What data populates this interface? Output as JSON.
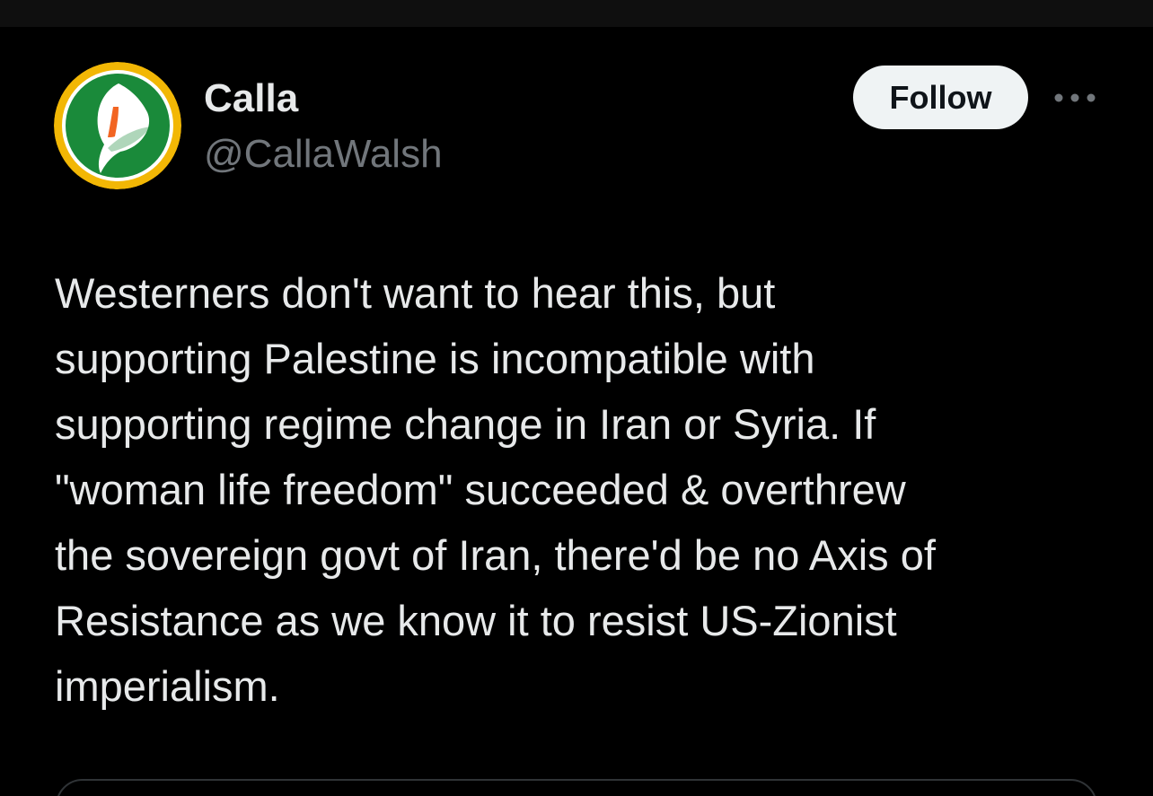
{
  "colors": {
    "background": "#000000",
    "text_primary": "#e7e9ea",
    "text_secondary": "#71767b",
    "follow_bg": "#eff3f4",
    "follow_text": "#0f1419",
    "avatar_ring": "#f2b705",
    "avatar_fill": "#1a8a3a",
    "avatar_flower": "#ffffff",
    "avatar_spadix": "#f26522"
  },
  "author": {
    "display_name": "Calla",
    "handle": "@CallaWalsh",
    "avatar_icon": "calla-lily-avatar"
  },
  "actions": {
    "follow_label": "Follow",
    "more_icon": "ellipsis-icon"
  },
  "tweet": {
    "lines": [
      "Westerners don't want to hear this, but",
      "supporting Palestine is incompatible with",
      "supporting regime change in Iran or Syria. If",
      "\"woman life freedom\" succeeded & overthrew",
      "the sovereign govt of Iran, there'd be no Axis of",
      "Resistance as we know it to resist US-Zionist",
      "imperialism."
    ]
  }
}
